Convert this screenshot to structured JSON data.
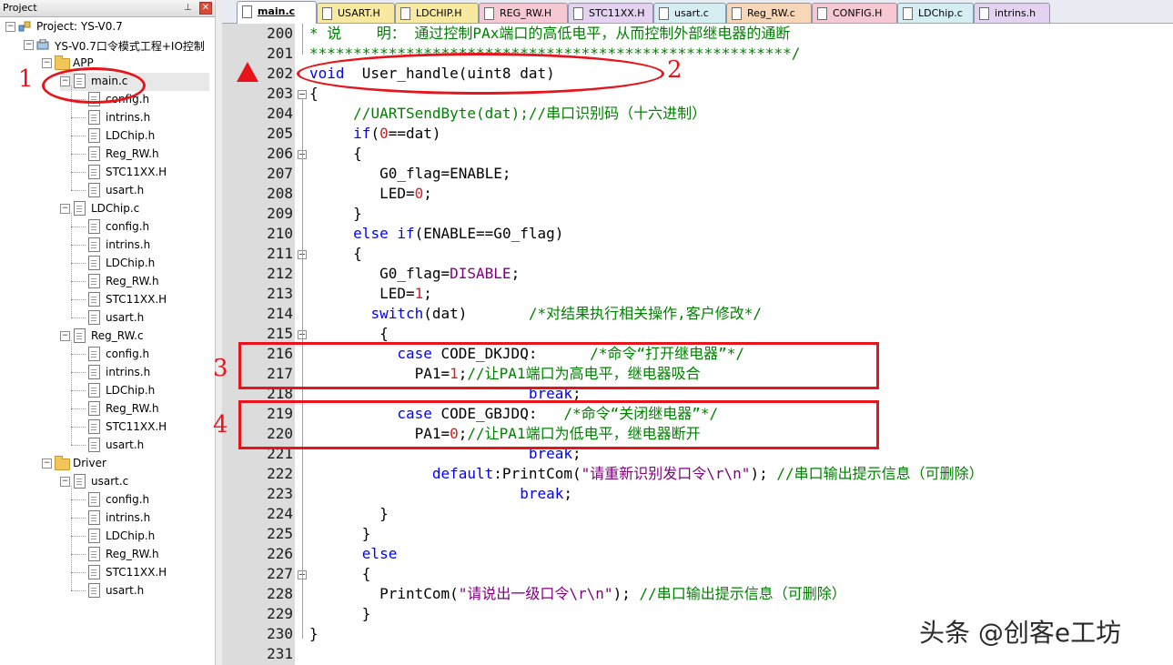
{
  "project_panel": {
    "title": "Project",
    "pin_icon": "pin-icon",
    "close_icon": "close-icon",
    "tree": [
      {
        "label": "Project: YS-V0.7",
        "icon": "project-icon",
        "level": 0,
        "expanded": true
      },
      {
        "label": "YS-V0.7口令模式工程+IO控制",
        "icon": "target-icon",
        "level": 1,
        "expanded": true
      },
      {
        "label": "APP",
        "icon": "folder-icon",
        "level": 2,
        "expanded": true
      },
      {
        "label": "main.c",
        "icon": "file-icon",
        "level": 3,
        "expanded": true,
        "selected": true
      },
      {
        "label": "config.h",
        "icon": "file-icon",
        "level": 4
      },
      {
        "label": "intrins.h",
        "icon": "file-icon",
        "level": 4
      },
      {
        "label": "LDChip.h",
        "icon": "file-icon",
        "level": 4
      },
      {
        "label": "Reg_RW.h",
        "icon": "file-icon",
        "level": 4
      },
      {
        "label": "STC11XX.H",
        "icon": "file-icon",
        "level": 4
      },
      {
        "label": "usart.h",
        "icon": "file-icon",
        "level": 4
      },
      {
        "label": "LDChip.c",
        "icon": "file-icon",
        "level": 3,
        "expanded": true
      },
      {
        "label": "config.h",
        "icon": "file-icon",
        "level": 4
      },
      {
        "label": "intrins.h",
        "icon": "file-icon",
        "level": 4
      },
      {
        "label": "LDChip.h",
        "icon": "file-icon",
        "level": 4
      },
      {
        "label": "Reg_RW.h",
        "icon": "file-icon",
        "level": 4
      },
      {
        "label": "STC11XX.H",
        "icon": "file-icon",
        "level": 4
      },
      {
        "label": "usart.h",
        "icon": "file-icon",
        "level": 4
      },
      {
        "label": "Reg_RW.c",
        "icon": "file-icon",
        "level": 3,
        "expanded": true
      },
      {
        "label": "config.h",
        "icon": "file-icon",
        "level": 4
      },
      {
        "label": "intrins.h",
        "icon": "file-icon",
        "level": 4
      },
      {
        "label": "LDChip.h",
        "icon": "file-icon",
        "level": 4
      },
      {
        "label": "Reg_RW.h",
        "icon": "file-icon",
        "level": 4
      },
      {
        "label": "STC11XX.H",
        "icon": "file-icon",
        "level": 4
      },
      {
        "label": "usart.h",
        "icon": "file-icon",
        "level": 4
      },
      {
        "label": "Driver",
        "icon": "folder-icon",
        "level": 2,
        "expanded": true
      },
      {
        "label": "usart.c",
        "icon": "file-icon",
        "level": 3,
        "expanded": true
      },
      {
        "label": "config.h",
        "icon": "file-icon",
        "level": 4
      },
      {
        "label": "intrins.h",
        "icon": "file-icon",
        "level": 4
      },
      {
        "label": "LDChip.h",
        "icon": "file-icon",
        "level": 4
      },
      {
        "label": "Reg_RW.h",
        "icon": "file-icon",
        "level": 4
      },
      {
        "label": "STC11XX.H",
        "icon": "file-icon",
        "level": 4
      },
      {
        "label": "usart.h",
        "icon": "file-icon",
        "level": 4
      }
    ]
  },
  "tabs": [
    {
      "label": "main.c",
      "color": "#ffffff",
      "active": true
    },
    {
      "label": "USART.H",
      "color": "#f7e9a0"
    },
    {
      "label": "LDCHIP.H",
      "color": "#f7e9a0"
    },
    {
      "label": "REG_RW.H",
      "color": "#f6c8d4"
    },
    {
      "label": "STC11XX.H",
      "color": "#e3d2f0"
    },
    {
      "label": "usart.c",
      "color": "#d4eef2"
    },
    {
      "label": "Reg_RW.c",
      "color": "#f8d6b8"
    },
    {
      "label": "CONFIG.H",
      "color": "#f6c8d4"
    },
    {
      "label": "LDChip.c",
      "color": "#d4eef2"
    },
    {
      "label": "intrins.h",
      "color": "#e3d2f0"
    }
  ],
  "editor": {
    "lines": [
      {
        "n": "200",
        "fold": false,
        "tokens": [
          [
            "cm",
            "* 说    明： 通过控制PAx端口的高低电平，从而控制外部继电器的通断"
          ]
        ]
      },
      {
        "n": "201",
        "fold": false,
        "foldEnd": true,
        "tokens": [
          [
            "cm",
            "*******************************************************/"
          ]
        ]
      },
      {
        "n": "202",
        "fold": false,
        "tokens": [
          [
            "kw",
            "void"
          ],
          [
            "",
            "  User_handle(uint8 dat)"
          ]
        ]
      },
      {
        "n": "203",
        "fold": true,
        "tokens": [
          [
            "",
            "{"
          ]
        ]
      },
      {
        "n": "204",
        "fold": false,
        "tokens": [
          [
            "",
            "     "
          ],
          [
            "cm",
            "//UARTSendByte(dat);//串口识别码（十六进制）"
          ]
        ]
      },
      {
        "n": "205",
        "fold": false,
        "tokens": [
          [
            "",
            "     "
          ],
          [
            "kw",
            "if"
          ],
          [
            "",
            "("
          ],
          [
            "nm",
            "0"
          ],
          [
            "",
            "==dat)"
          ]
        ]
      },
      {
        "n": "206",
        "fold": true,
        "tokens": [
          [
            "",
            "     {"
          ]
        ]
      },
      {
        "n": "207",
        "fold": false,
        "tokens": [
          [
            "",
            "        G0_flag=ENABLE;"
          ]
        ]
      },
      {
        "n": "208",
        "fold": false,
        "tokens": [
          [
            "",
            "        LED="
          ],
          [
            "nm",
            "0"
          ],
          [
            "",
            ";"
          ]
        ]
      },
      {
        "n": "209",
        "fold": false,
        "tokens": [
          [
            "",
            "     }"
          ]
        ]
      },
      {
        "n": "210",
        "fold": false,
        "tokens": [
          [
            "",
            "     "
          ],
          [
            "kw",
            "else if"
          ],
          [
            "",
            "(ENABLE==G0_flag)"
          ]
        ]
      },
      {
        "n": "211",
        "fold": true,
        "tokens": [
          [
            "",
            "     {"
          ]
        ]
      },
      {
        "n": "212",
        "fold": false,
        "tokens": [
          [
            "",
            "        G0_flag="
          ],
          [
            "st",
            "DISABLE"
          ],
          [
            "",
            ";"
          ]
        ]
      },
      {
        "n": "213",
        "fold": false,
        "tokens": [
          [
            "",
            "        LED="
          ],
          [
            "nm",
            "1"
          ],
          [
            "",
            ";"
          ]
        ]
      },
      {
        "n": "214",
        "fold": false,
        "tokens": [
          [
            "",
            "       "
          ],
          [
            "kw",
            "switch"
          ],
          [
            "",
            "(dat)       "
          ],
          [
            "cm",
            "/*对结果执行相关操作,客户修改*/"
          ]
        ]
      },
      {
        "n": "215",
        "fold": true,
        "tokens": [
          [
            "",
            "        {"
          ]
        ]
      },
      {
        "n": "216",
        "fold": false,
        "tokens": [
          [
            "",
            "          "
          ],
          [
            "kw",
            "case"
          ],
          [
            "",
            " CODE_DKJDQ:      "
          ],
          [
            "cm",
            "/*命令“打开继电器”*/"
          ]
        ]
      },
      {
        "n": "217",
        "fold": false,
        "tokens": [
          [
            "",
            "            PA1="
          ],
          [
            "nm",
            "1"
          ],
          [
            "",
            ";"
          ],
          [
            "cm",
            "//让PA1端口为高电平，继电器吸合"
          ]
        ]
      },
      {
        "n": "218",
        "fold": false,
        "tokens": [
          [
            "",
            "                         "
          ],
          [
            "kw",
            "break"
          ],
          [
            "",
            ";"
          ]
        ]
      },
      {
        "n": "219",
        "fold": false,
        "tokens": [
          [
            "",
            "          "
          ],
          [
            "kw",
            "case"
          ],
          [
            "",
            " CODE_GBJDQ:   "
          ],
          [
            "cm",
            "/*命令“关闭继电器”*/"
          ]
        ]
      },
      {
        "n": "220",
        "fold": false,
        "tokens": [
          [
            "",
            "            PA1="
          ],
          [
            "nm",
            "0"
          ],
          [
            "",
            ";"
          ],
          [
            "cm",
            "//让PA1端口为低电平，继电器断开"
          ]
        ]
      },
      {
        "n": "221",
        "fold": false,
        "tokens": [
          [
            "",
            "                         "
          ],
          [
            "kw",
            "break"
          ],
          [
            "",
            ";"
          ]
        ]
      },
      {
        "n": "222",
        "fold": false,
        "tokens": [
          [
            "",
            "              "
          ],
          [
            "kw",
            "default"
          ],
          [
            "",
            ":PrintCom("
          ],
          [
            "st",
            "\"请重新识别发口令\\r\\n\""
          ],
          [
            "",
            "); "
          ],
          [
            "cm",
            "//串口输出提示信息（可删除）"
          ]
        ]
      },
      {
        "n": "223",
        "fold": false,
        "tokens": [
          [
            "",
            "                        "
          ],
          [
            "kw",
            "break"
          ],
          [
            "",
            ";"
          ]
        ]
      },
      {
        "n": "224",
        "fold": false,
        "tokens": [
          [
            "",
            "        }"
          ]
        ]
      },
      {
        "n": "225",
        "fold": false,
        "tokens": [
          [
            "",
            "      }"
          ]
        ]
      },
      {
        "n": "226",
        "fold": false,
        "tokens": [
          [
            "",
            "      "
          ],
          [
            "kw",
            "else"
          ]
        ]
      },
      {
        "n": "227",
        "fold": true,
        "tokens": [
          [
            "",
            "      {"
          ]
        ]
      },
      {
        "n": "228",
        "fold": false,
        "tokens": [
          [
            "",
            "        PrintCom("
          ],
          [
            "st",
            "\"请说出一级口令\\r\\n\""
          ],
          [
            "",
            "); "
          ],
          [
            "cm",
            "//串口输出提示信息（可删除）"
          ]
        ]
      },
      {
        "n": "229",
        "fold": false,
        "tokens": [
          [
            "",
            "      }"
          ]
        ]
      },
      {
        "n": "230",
        "fold": false,
        "tokens": [
          [
            "",
            "}"
          ]
        ]
      },
      {
        "n": "231",
        "fold": false,
        "tokens": [
          [
            "",
            ""
          ]
        ]
      }
    ]
  },
  "annotations": {
    "label1": "1",
    "label2": "2",
    "label3": "3",
    "label4": "4",
    "color": "#e8141c"
  },
  "watermark": "头条 @创客e工坊"
}
